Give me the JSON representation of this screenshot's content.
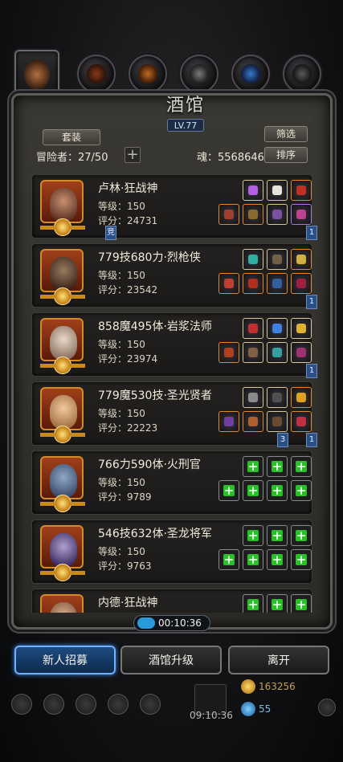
{
  "top_tabs": [
    {
      "name": "tavern",
      "active": true
    },
    {
      "name": "tab-2",
      "active": false
    },
    {
      "name": "tab-3",
      "active": false
    },
    {
      "name": "tab-4",
      "active": false
    },
    {
      "name": "tab-5",
      "active": false
    },
    {
      "name": "tab-6",
      "active": false
    }
  ],
  "header": {
    "title": "酒馆",
    "level": "LV.77",
    "set_label": "套装",
    "filter_label": "筛选",
    "sort_label": "排序",
    "adventurers": "冒险者：27/50",
    "soul": "魂：5568646"
  },
  "heroes": [
    {
      "name": "卢林·狂战神",
      "level": "等级：150",
      "score": "评分：24731",
      "flag_left": "竞",
      "flag_right": "1",
      "slots": [
        "g",
        "g",
        "o",
        "o",
        "o",
        "g",
        "p",
        "p"
      ]
    },
    {
      "name": "779技680力·烈枪侠",
      "level": "等级：150",
      "score": "评分：23542",
      "flag_right": "1",
      "slots": [
        "g",
        "g",
        "o",
        "o",
        "o",
        "o",
        "o",
        "o"
      ]
    },
    {
      "name": "858魔495体·岩浆法师",
      "level": "等级：150",
      "score": "评分：23974",
      "flag_right": "1",
      "slots": [
        "g",
        "g",
        "g",
        "g",
        "o",
        "g",
        "g",
        "g"
      ]
    },
    {
      "name": "779魔530技·圣光贤者",
      "level": "等级：150",
      "score": "评分：22223",
      "flag_right": "1",
      "slots": [
        "g",
        "g",
        "o",
        "p",
        "o",
        "o",
        "g",
        "o"
      ]
    },
    {
      "name": "766力590体·火刑官",
      "level": "等级：150",
      "score": "评分：9789",
      "flag_left_top": "3",
      "flag_right": "1",
      "slots": [
        "e",
        "e",
        "e",
        "e",
        "e",
        "e",
        "e"
      ]
    },
    {
      "name": "546技632体·圣龙将军",
      "level": "等级：150",
      "score": "评分：9763",
      "slots": [
        "e",
        "e",
        "e",
        "e",
        "e",
        "e",
        "e"
      ]
    },
    {
      "name": "内德·狂战神",
      "level": "",
      "score": "",
      "slots": [
        "e",
        "e",
        "e"
      ]
    }
  ],
  "timer": "00:10:36",
  "buttons": {
    "recruit": "新人招募",
    "upgrade": "酒馆升级",
    "leave": "离开"
  },
  "resources": {
    "gold": "163256",
    "gems": "55",
    "chest_timer": "09:10:36"
  },
  "colors": {
    "accent_blue": "#3a90ff",
    "plus_green": "#2bbf2b",
    "frame": "#3a3833"
  }
}
